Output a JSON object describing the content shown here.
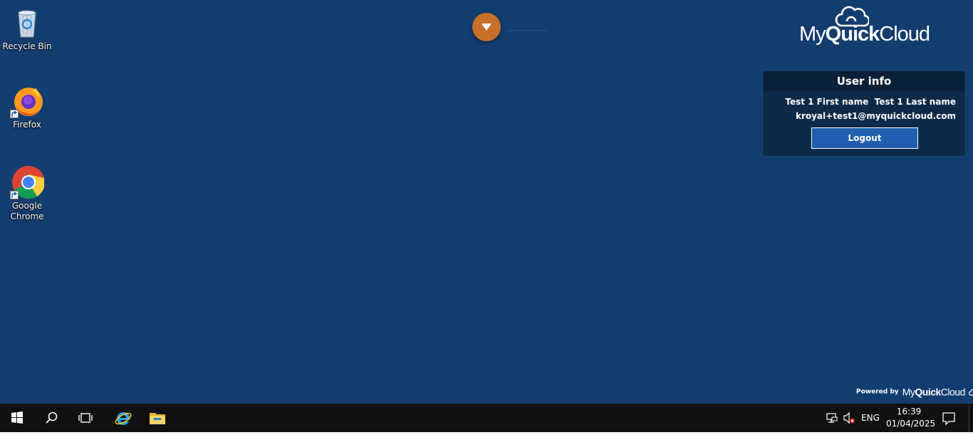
{
  "desktop": {
    "background": "#133d6e",
    "icons": [
      {
        "label": "Recycle Bin",
        "icon": "recycle-bin-icon"
      },
      {
        "label": "Firefox",
        "icon": "firefox-icon"
      },
      {
        "label": "Google Chrome",
        "icon": "chrome-icon"
      }
    ]
  },
  "toolbar_toggle": {
    "icon": "chevron-down-icon",
    "color": "#c8702a"
  },
  "brand": {
    "name_part1": "My",
    "name_part2": "Quick",
    "name_part3": "Cloud"
  },
  "user_info": {
    "title": "User info",
    "full_name": "Test 1 First name  Test 1 Last name",
    "email": "kroyal+test1@myquickcloud.com",
    "logout_label": "Logout"
  },
  "footer": {
    "powered_by": "Powered by",
    "brand_part1": "My",
    "brand_part2": "Quick",
    "brand_part3": "Cloud"
  },
  "taskbar": {
    "buttons": [
      "start-icon",
      "search-icon",
      "task-view-icon",
      "internet-explorer-icon",
      "file-explorer-icon"
    ],
    "tray": {
      "language": "ENG",
      "time": "16:39",
      "date": "01/04/2025"
    }
  }
}
